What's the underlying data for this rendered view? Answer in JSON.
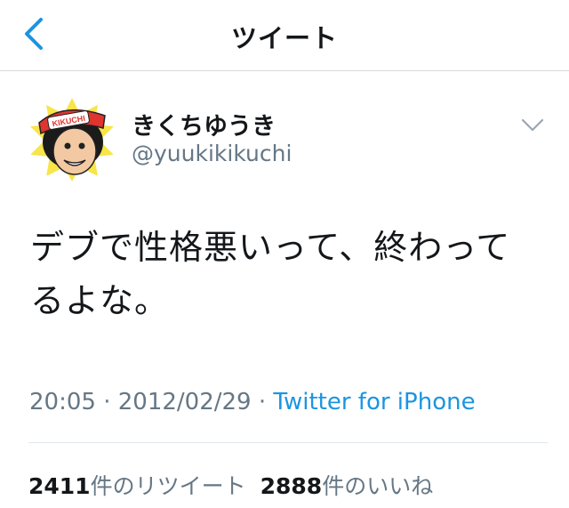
{
  "nav": {
    "title": "ツイート"
  },
  "tweet": {
    "author": {
      "display_name": "きくちゆうき",
      "handle": "@yuukikikuchi",
      "avatar_cap_text": "KIKUCHI"
    },
    "text_line1": "デブで性格悪いって、終わって",
    "text_line2": "るよな。",
    "time": "20:05",
    "separator": " · ",
    "date": "2012/02/29",
    "source": "Twitter for iPhone"
  },
  "stats": {
    "retweet_count": "2411",
    "retweet_label": "件のリツイート",
    "like_count": "2888",
    "like_label": "件のいいね"
  },
  "colors": {
    "accent": "#1b95e0",
    "secondary_text": "#657786",
    "primary_text": "#14171a",
    "border": "#d6d9dc"
  },
  "icons": {
    "back": "chevron-left-icon",
    "more": "chevron-down-icon"
  }
}
